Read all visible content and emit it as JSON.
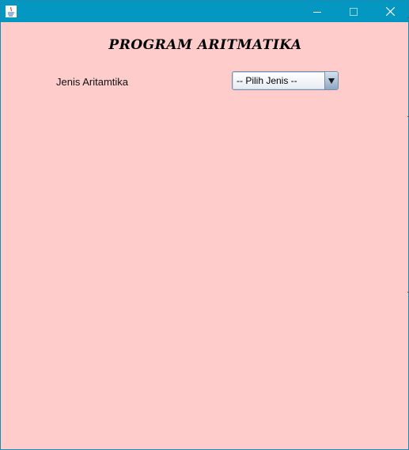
{
  "window": {
    "title": "",
    "titlebar_color": "#0497c1",
    "background_color": "#ffcccc",
    "controls": {
      "minimize_icon": "minimize-icon",
      "maximize_icon": "maximize-icon",
      "close_icon": "close-icon"
    },
    "app_icon": "java-icon"
  },
  "form": {
    "heading": "PROGRAM ARITMATIKA",
    "jenis_label": "Jenis Aritamtika",
    "jenis_select": {
      "selected": "-- Pilih Jenis --",
      "arrow_icon": "dropdown-arrow-icon"
    }
  }
}
